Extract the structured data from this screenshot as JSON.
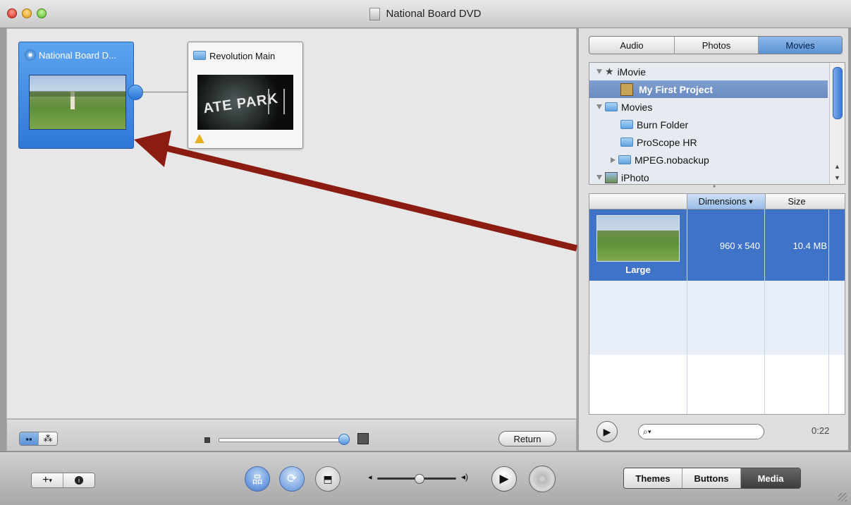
{
  "window": {
    "title": "National Board DVD"
  },
  "menu_nodes": [
    {
      "label": "National Board D..."
    },
    {
      "label": "Revolution Main",
      "thumb_text": "ATE PARK"
    }
  ],
  "left_footer": {
    "return_label": "Return"
  },
  "media_tabs": {
    "items": [
      "Audio",
      "Photos",
      "Movies"
    ],
    "selected": "Movies"
  },
  "tree": [
    {
      "label": "iMovie"
    },
    {
      "label": "My First Project"
    },
    {
      "label": "Movies"
    },
    {
      "label": "Burn Folder"
    },
    {
      "label": "ProScope HR"
    },
    {
      "label": "MPEG.nobackup"
    },
    {
      "label": "iPhoto"
    }
  ],
  "table": {
    "columns": [
      "Dimensions",
      "Size"
    ],
    "rows": [
      {
        "name": "Large",
        "dimensions": "960 x 540",
        "size": "10.4 MB"
      }
    ]
  },
  "search": {
    "placeholder": "",
    "time": "0:22"
  },
  "bottom_tabs": {
    "items": [
      "Themes",
      "Buttons",
      "Media"
    ],
    "selected": "Media"
  },
  "colors": {
    "selection_blue": "#3f73c7",
    "arrow": "#8b1c12",
    "menu_node_blue": "#3b86e0"
  }
}
